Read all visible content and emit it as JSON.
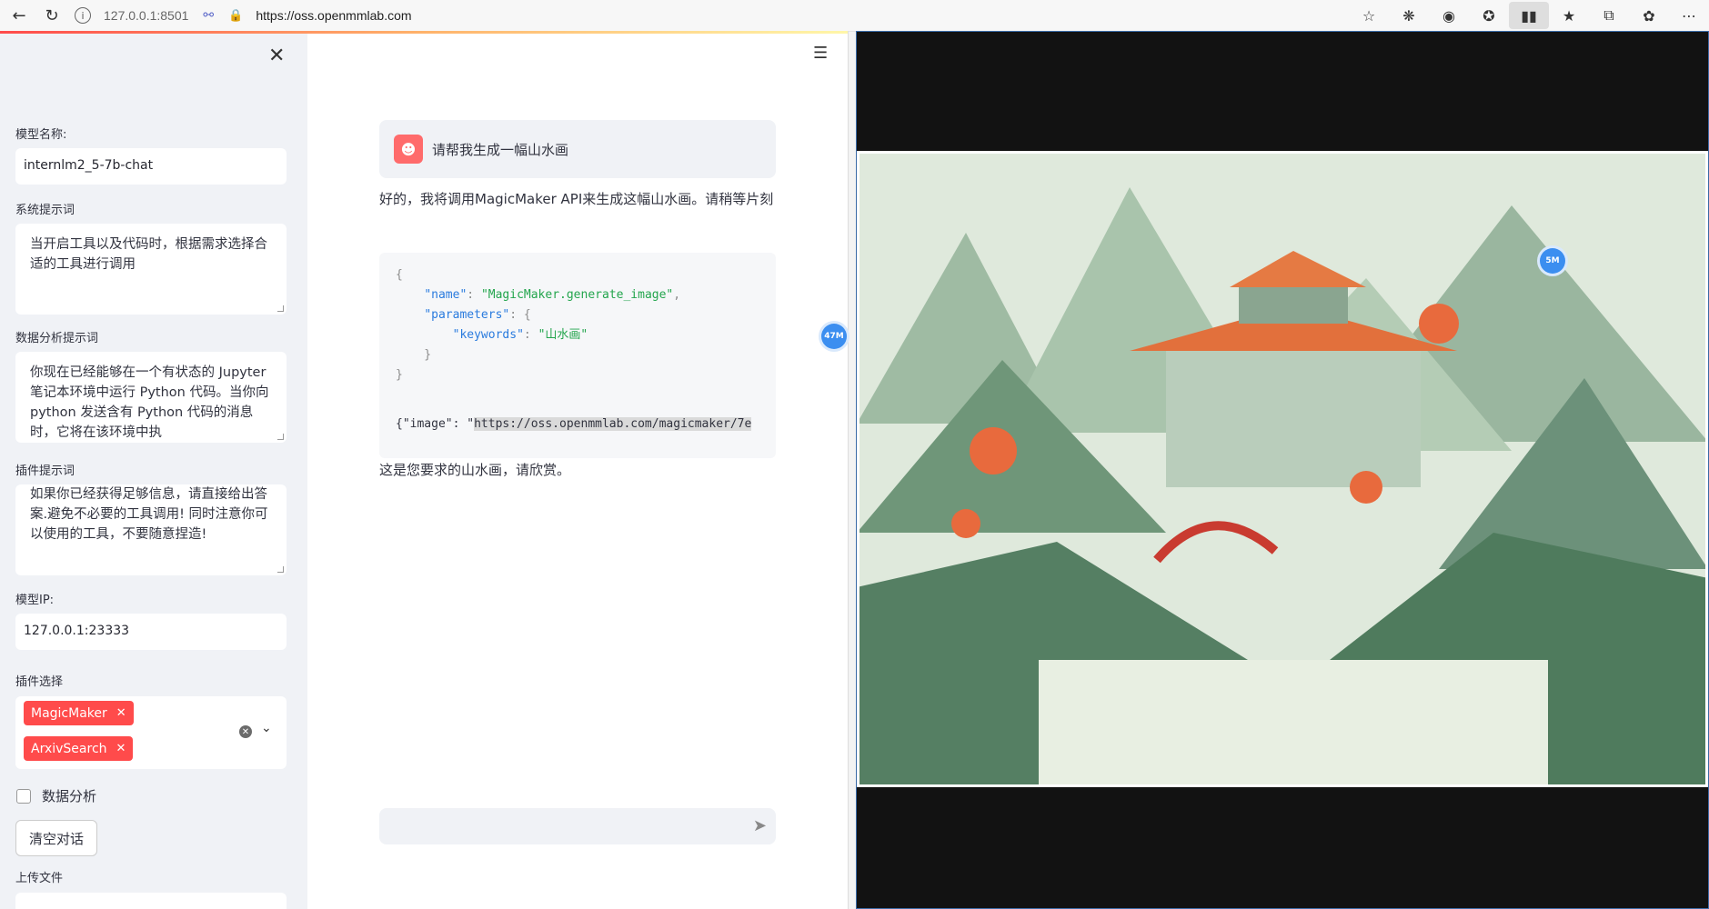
{
  "browser": {
    "host": "127.0.0.1:8501",
    "url": "https://oss.openmmlab.com",
    "icons": [
      "back-icon",
      "reload-icon",
      "star-icon",
      "extension-icon",
      "cookie-icon",
      "puzzle-icon",
      "reader-icon",
      "favorites-icon",
      "collections-icon",
      "performance-icon",
      "more-icon"
    ]
  },
  "sidebar": {
    "model_name_label": "模型名称:",
    "model_name_value": "internlm2_5-7b-chat",
    "system_prompt_label": "系统提示词",
    "system_prompt_value": "当开启工具以及代码时，根据需求选择合适的工具进行调用",
    "data_prompt_label": "数据分析提示词",
    "data_prompt_value": "你现在已经能够在一个有状态的 Jupyter 笔记本环境中运行 Python 代码。当你向 python 发送含有 Python 代码的消息时，它将在该环境中执",
    "plugin_prompt_label": "插件提示词",
    "plugin_prompt_value": "如果你已经获得足够信息，请直接给出答案.避免不必要的工具调用! 同时注意你可以使用的工具，不要随意捏造!",
    "model_ip_label": "模型IP:",
    "model_ip_value": "127.0.0.1:23333",
    "plugin_select_label": "插件选择",
    "plugins": [
      "MagicMaker",
      "ArxivSearch"
    ],
    "data_analysis_label": "数据分析",
    "clear_button": "清空对话",
    "upload_label": "上传文件"
  },
  "chat": {
    "user_message": "请帮我生成一幅山水画",
    "assistant_reply_1": "好的，我将调用MagicMaker API来生成这幅山水画。请稍等片刻",
    "code": {
      "name_key": "\"name\"",
      "name_value": "\"MagicMaker.generate_image\"",
      "params_key": "\"parameters\"",
      "keywords_key": "\"keywords\"",
      "keywords_value": "\"山水画\""
    },
    "result_prefix": "{\"image\": \"",
    "result_url": "https://oss.openmmlab.com/magicmaker/7e",
    "assistant_reply_2": "这是您要求的山水画，请欣赏。",
    "badge_left": "47M",
    "badge_right": "5M"
  },
  "colors": {
    "accent": "#ff4b4b",
    "sidebar_bg": "#f0f2f6",
    "badge": "#3b8ef0"
  }
}
